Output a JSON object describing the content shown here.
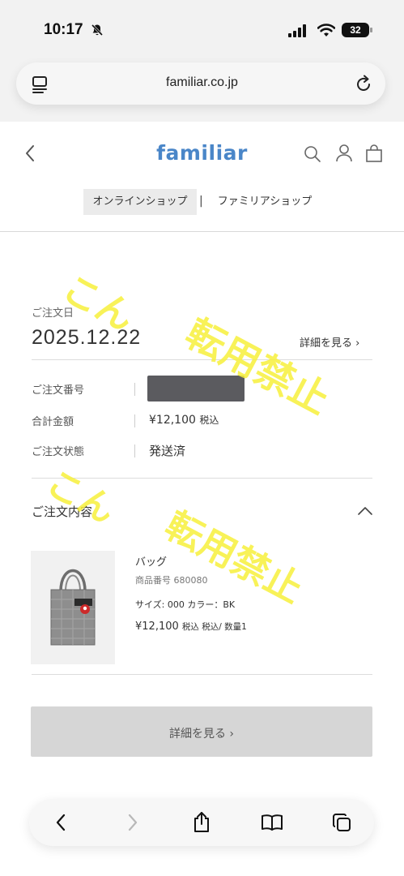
{
  "status_bar": {
    "time": "10:17",
    "battery": "32"
  },
  "browser": {
    "url": "familiar.co.jp"
  },
  "site": {
    "logo": "familiar",
    "segments": {
      "online": "オンラインショップ",
      "separator": "|",
      "familia": "ファミリアショップ"
    }
  },
  "order": {
    "date_label": "ご注文日",
    "date": "2025.12.22",
    "detail_link": "詳細を見る ›",
    "number_label": "ご注文番号",
    "amount_label": "合計金額",
    "amount": "¥12,100",
    "amount_tax": "税込",
    "status_label": "ご注文状態",
    "status": "発送済"
  },
  "contents": {
    "title": "ご注文内容",
    "item": {
      "name": "バッグ",
      "code": "商品番号 680080",
      "size_color": "サイズ: 000 カラー：BK",
      "price": "¥12,100",
      "price_note": "税込 税込/ 数量1"
    },
    "detail_button": "詳細を見る ›"
  },
  "watermarks": {
    "kon": "こん",
    "tenyou": "転用禁止"
  },
  "colors": {
    "brand": "#4a86c8",
    "watermark": "#f7f03c"
  },
  "icons": [
    "bell-slash-icon",
    "signal-icon",
    "wifi-icon",
    "battery-icon",
    "tabs-icon",
    "reload-icon",
    "back-chevron-icon",
    "search-icon",
    "user-icon",
    "bag-icon",
    "chevron-up-icon",
    "back-icon",
    "forward-icon",
    "share-icon",
    "bookmarks-icon",
    "tabs-overview-icon"
  ]
}
